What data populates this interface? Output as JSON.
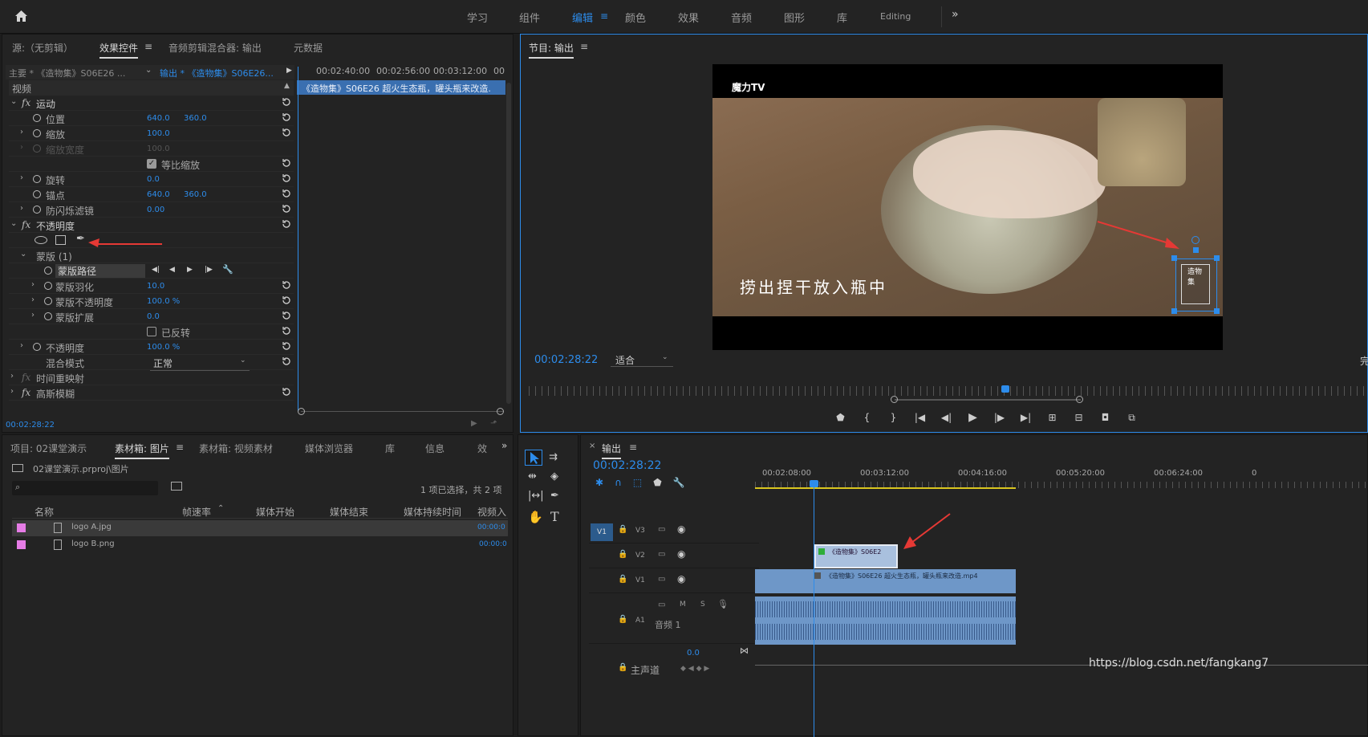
{
  "workspaces": [
    "学习",
    "组件",
    "编辑",
    "颜色",
    "效果",
    "音频",
    "图形",
    "库",
    "Editing"
  ],
  "active_workspace": "编辑",
  "effect_controls": {
    "tabs": [
      "源:（无剪辑）",
      "效果控件",
      "音频剪辑混合器: 输出",
      "元数据"
    ],
    "master_clip": "主要 * 《造物集》S06E26 ...",
    "seq_clip": "输出 * 《造物集》S06E26...",
    "ruler": [
      "00:02:40:00",
      "00:02:56:00",
      "00:03:12:00",
      "00"
    ],
    "clip_bar": "《造物集》S06E26 超火生态瓶，罐头瓶来改造.",
    "section_video": "视频",
    "motion": "运动",
    "position_label": "位置",
    "position_x": "640.0",
    "position_y": "360.0",
    "scale_label": "缩放",
    "scale": "100.0",
    "scale_w_label": "缩放宽度",
    "scale_w": "100.0",
    "uniform_label": "等比缩放",
    "rotation_label": "旋转",
    "rotation": "0.0",
    "anchor_label": "锚点",
    "anchor_x": "640.0",
    "anchor_y": "360.0",
    "flicker_label": "防闪烁滤镜",
    "flicker": "0.00",
    "opacity_section": "不透明度",
    "mask_label": "蒙版 (1)",
    "mask_path": "蒙版路径",
    "mask_feather_label": "蒙版羽化",
    "mask_feather": "10.0",
    "mask_opacity_label": "蒙版不透明度",
    "mask_opacity": "100.0 %",
    "mask_expand_label": "蒙版扩展",
    "mask_expand": "0.0",
    "inverted_label": "已反转",
    "opacity_label": "不透明度",
    "opacity": "100.0 %",
    "blend_label": "混合模式",
    "blend": "正常",
    "time_remap": "时间重映射",
    "gaussian": "高斯模糊",
    "timecode": "00:02:28:22"
  },
  "program": {
    "title": "节目: 输出",
    "watermark": "魔力TV",
    "subtitle": "捞出捏干放入瓶中",
    "logo_text": "造物集",
    "timecode": "00:02:28:22",
    "fit": "适合",
    "right_cut": "完"
  },
  "project": {
    "tabs": [
      "项目: 02课堂演示",
      "素材箱: 图片",
      "素材箱: 视频素材",
      "媒体浏览器",
      "库",
      "信息",
      "效"
    ],
    "path": "02课堂演示.prproj\\图片",
    "selection": "1 项已选择，共 2 项",
    "columns": [
      "名称",
      "帧速率",
      "媒体开始",
      "媒体结束",
      "媒体持续时间",
      "视频入"
    ],
    "rows": [
      {
        "name": "logo A.jpg",
        "in": "00:00:0"
      },
      {
        "name": "logo B.png",
        "in": "00:00:0"
      }
    ]
  },
  "timeline": {
    "title": "输出",
    "timecode": "00:02:28:22",
    "ruler": [
      "00:02:08:00",
      "00:03:12:00",
      "00:04:16:00",
      "00:05:20:00",
      "00:06:24:00",
      "0"
    ],
    "tracks": [
      "V3",
      "V2",
      "V1",
      "A1"
    ],
    "v1_target": "V1",
    "audio_label": "音频 1",
    "audio_m": "M",
    "audio_s": "S",
    "master_label": "主声道",
    "master_value": "0.0",
    "clip_v2": "《造物集》S06E2",
    "clip_v1": "《造物集》S06E26 超火生态瓶，罐头瓶来改造.mp4"
  },
  "watermark_url": "https://blog.csdn.net/fangkang7",
  "colors": {
    "accent": "#2d8ceb",
    "clip_blue": "#6e97c8",
    "arrow_red": "#e53935",
    "label_pink": "#e67ce6"
  }
}
